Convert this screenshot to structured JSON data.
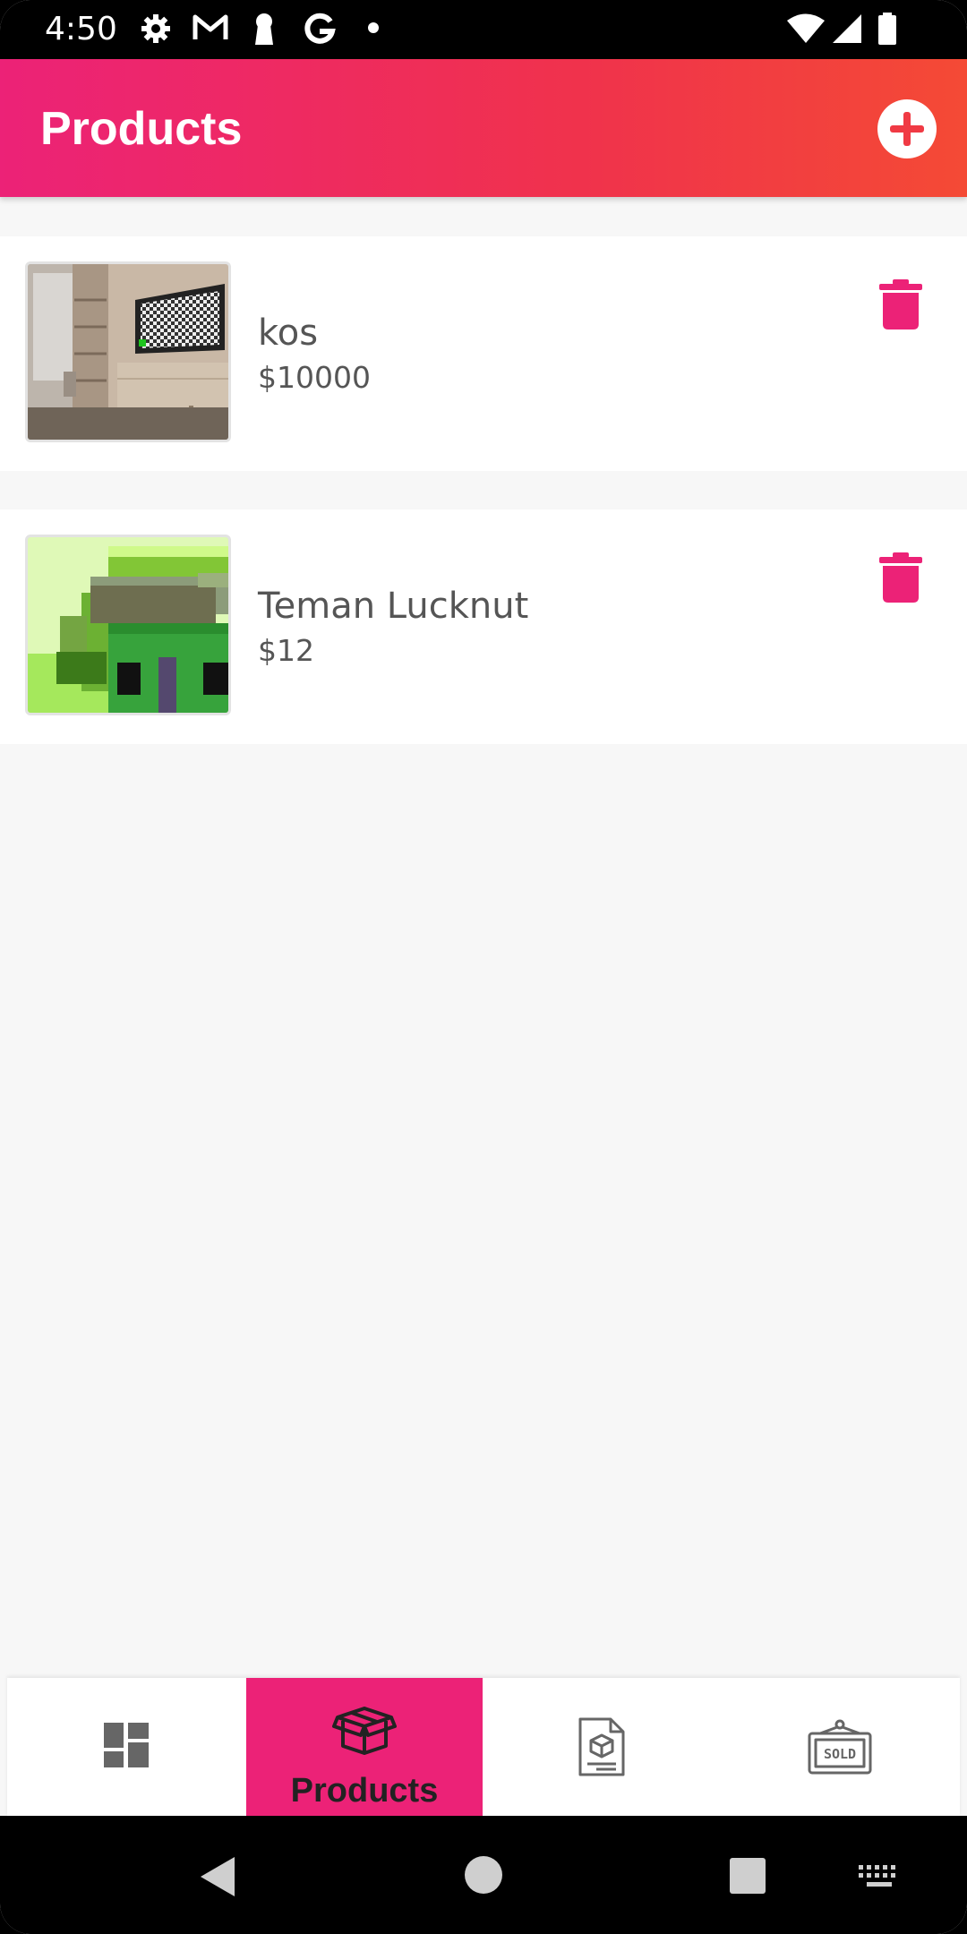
{
  "status_bar": {
    "time": "4:50",
    "left_icons": [
      "gear-icon",
      "gmail-icon",
      "keyhole-icon",
      "google-g-icon",
      "dot-icon"
    ],
    "right_icons": [
      "wifi-icon",
      "signal-icon",
      "battery-icon"
    ]
  },
  "header": {
    "title": "Products",
    "add_icon": "plus-circle-icon"
  },
  "products": [
    {
      "name": "kos",
      "price": "$10000",
      "image": "living-room-tv-thumbnail",
      "delete_icon": "trash-icon"
    },
    {
      "name": "Teman Lucknut",
      "price": "$12",
      "image": "pixel-art-house-thumbnail",
      "delete_icon": "trash-icon"
    }
  ],
  "bottom_nav": {
    "active": "Products",
    "items": [
      {
        "id": "dashboard",
        "icon": "dashboard-icon",
        "label": ""
      },
      {
        "id": "products",
        "icon": "box-icon",
        "label": "Products"
      },
      {
        "id": "invoices",
        "icon": "document-box-icon",
        "label": ""
      },
      {
        "id": "sold",
        "icon": "sold-sign-icon",
        "label": ""
      }
    ]
  },
  "colors": {
    "accent": "#ec2277",
    "header_gradient_end": "#f44a35",
    "text": "#555555",
    "background": "#f7f7f7"
  },
  "system_nav": [
    "back-icon",
    "home-icon",
    "recents-icon",
    "keyboard-icon"
  ]
}
